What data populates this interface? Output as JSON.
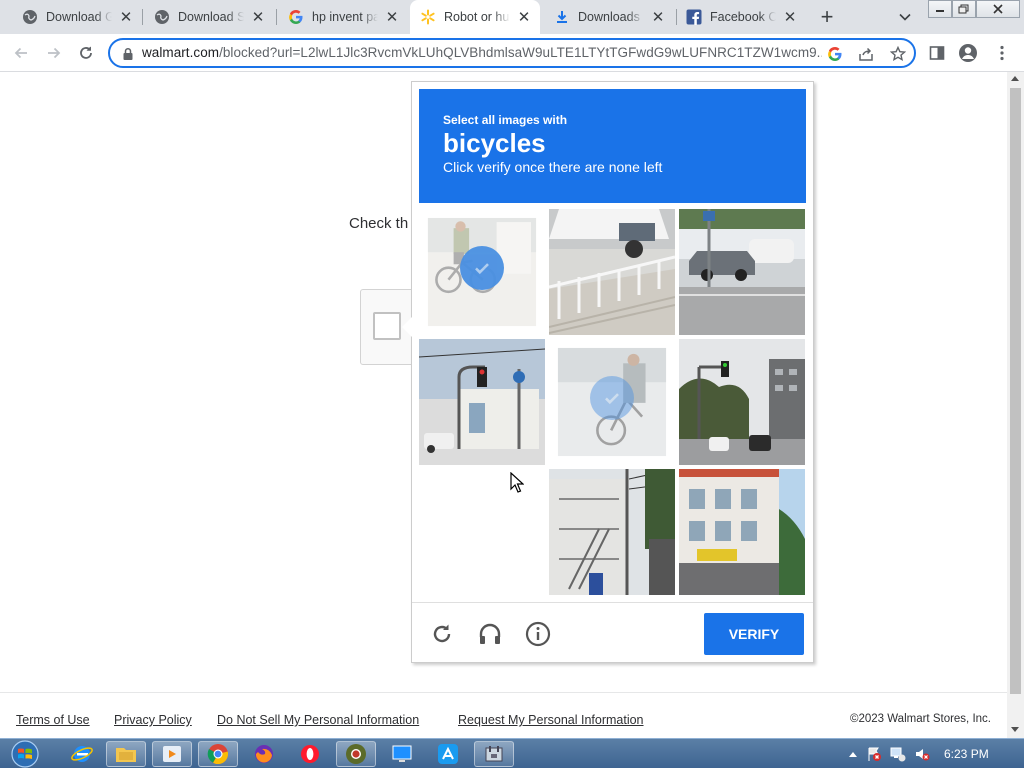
{
  "browser": {
    "tabs": [
      {
        "title": "Download G",
        "favicon": "globe-icon"
      },
      {
        "title": "Download Se",
        "favicon": "globe-icon"
      },
      {
        "title": "hp invent pa",
        "favicon": "google-icon"
      },
      {
        "title": "Robot or hu",
        "favicon": "walmart-spark-icon",
        "active": true
      },
      {
        "title": "Downloads",
        "favicon": "download-icon"
      },
      {
        "title": "Facebook Ch",
        "favicon": "facebook-icon"
      }
    ],
    "url_host": "walmart.com",
    "url_rest": "/blocked?url=L2lwL1Jlc3RvcmVkLUhQLVBhdmlsaW9uLTE1LTYtTGFwdG9wLUFNRC1TZW1wcm9..."
  },
  "page": {
    "check_text": "Check th",
    "footer_links": [
      "Terms of Use",
      "Privacy Policy",
      "Do Not Sell My Personal Information",
      "Request My Personal Information"
    ],
    "copyright": "©2023 Walmart Stores, Inc."
  },
  "captcha": {
    "instruction_line1": "Select all images with",
    "target_word": "bicycles",
    "instruction_line3": "Click verify once there are none left",
    "verify_label": "VERIFY",
    "header_color": "#1a73e8",
    "tiles": [
      {
        "content": "bicycle-with-rider",
        "state": "selected"
      },
      {
        "content": "stairs-and-cars",
        "state": "normal"
      },
      {
        "content": "parked-cars-street",
        "state": "normal"
      },
      {
        "content": "traffic-light-building",
        "state": "normal"
      },
      {
        "content": "bicycle-fading",
        "state": "selected-fading"
      },
      {
        "content": "street-traffic-light",
        "state": "normal"
      },
      {
        "content": "empty-loading",
        "state": "blank"
      },
      {
        "content": "building-stairs",
        "state": "normal"
      },
      {
        "content": "shop-building",
        "state": "normal"
      }
    ]
  },
  "taskbar": {
    "clock": "6:23 PM",
    "apps": [
      "internet-explorer-icon",
      "file-explorer-icon",
      "media-player-icon",
      "chrome-icon",
      "firefox-icon",
      "opera-icon",
      "chrome-dev-icon",
      "remote-desktop-icon",
      "app-store-icon",
      "tool-icon"
    ]
  }
}
